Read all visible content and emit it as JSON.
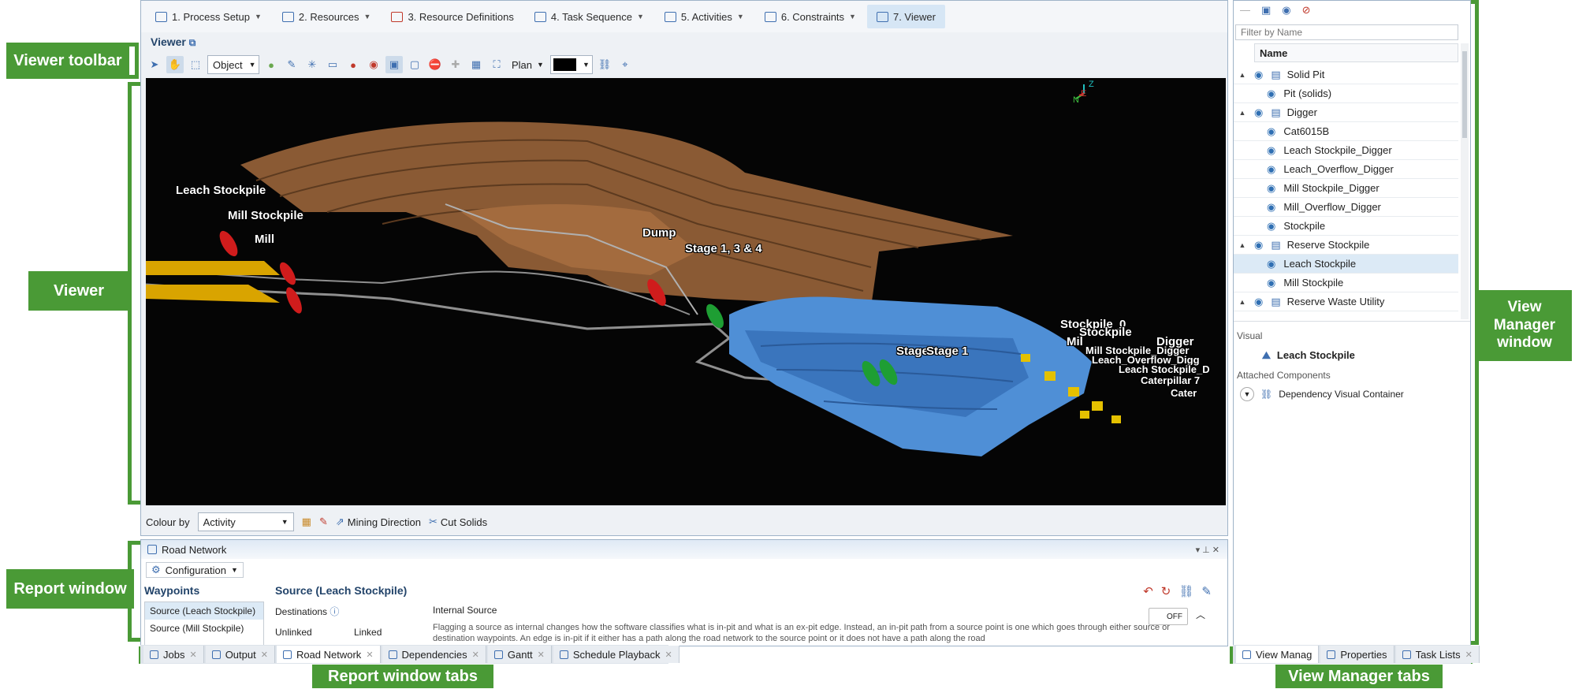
{
  "callouts": {
    "viewer_toolbar": "Viewer toolbar",
    "viewer": "Viewer",
    "report_window": "Report window",
    "report_window_tabs": "Report window tabs",
    "view_manager_window": "View Manager window",
    "view_manager_tabs": "View Manager tabs"
  },
  "tabs": [
    {
      "label": "1. Process Setup",
      "has_menu": true
    },
    {
      "label": "2. Resources",
      "has_menu": true
    },
    {
      "label": "3. Resource Definitions",
      "has_menu": false
    },
    {
      "label": "4. Task Sequence",
      "has_menu": true
    },
    {
      "label": "5. Activities",
      "has_menu": true
    },
    {
      "label": "6. Constraints",
      "has_menu": true
    },
    {
      "label": "7. Viewer",
      "has_menu": false
    }
  ],
  "viewer": {
    "title": "Viewer",
    "select_mode": "Object",
    "view_mode": "Plan",
    "labels": {
      "leach_stockpile": "Leach Stockpile",
      "mill_stockpile": "Mill Stockpile",
      "mill": "Mill",
      "dump": "Dump",
      "stage_134": "Stage 1, 3 & 4",
      "stage_1": "Stage 1",
      "stage_overlap": "Stage",
      "stockpile_0": "Stockpile_0",
      "stockpile": "Stockpile",
      "mill_short": "Mil",
      "digger": "Digger",
      "cat": "Caterpillar 7",
      "cat2": "Cater",
      "leach_overflow": "Leach_Overflow_Digg",
      "leach_stockpile_d": "Leach Stockpile_D",
      "mill_stockpile_digger": "Mill Stockpile_Digger"
    },
    "axis": {
      "z": "Z",
      "e": "E",
      "n": "N"
    }
  },
  "colour_bar": {
    "label": "Colour by",
    "value": "Activity",
    "mining_direction": "Mining Direction",
    "cut_solids": "Cut Solids"
  },
  "report": {
    "title": "Road Network",
    "configuration": "Configuration",
    "waypoints_heading": "Waypoints",
    "waypoints": [
      "Source (Leach Stockpile)",
      "Source (Mill Stockpile)"
    ],
    "source_heading": "Source (Leach Stockpile)",
    "destinations": "Destinations",
    "unlinked": "Unlinked",
    "linked": "Linked",
    "internal_source": "Internal Source",
    "toggle": "OFF",
    "description": "Flagging a source as internal changes how the software classifies what is in-pit and what is an ex-pit edge. Instead, an in-pit path from a source point is one which goes through either source or destination waypoints. An edge is in-pit if it either has a path along the road network to the source point or it does not have a path along the road"
  },
  "report_tabs": [
    "Jobs",
    "Output",
    "Road Network",
    "Dependencies",
    "Gantt",
    "Schedule Playback"
  ],
  "view_manager": {
    "filter_placeholder": "Filter by Name",
    "column": "Name",
    "items": [
      {
        "label": "Solid Pit",
        "level": 0
      },
      {
        "label": "Pit (solids)",
        "level": 1
      },
      {
        "label": "Digger",
        "level": 0
      },
      {
        "label": "Cat6015B",
        "level": 1
      },
      {
        "label": "Leach Stockpile_Digger",
        "level": 1
      },
      {
        "label": "Leach_Overflow_Digger",
        "level": 1
      },
      {
        "label": "Mill Stockpile_Digger",
        "level": 1
      },
      {
        "label": "Mill_Overflow_Digger",
        "level": 1
      },
      {
        "label": "Stockpile",
        "level": 1
      },
      {
        "label": "Reserve Stockpile",
        "level": 0
      },
      {
        "label": "Leach Stockpile",
        "level": 1
      },
      {
        "label": "Mill Stockpile",
        "level": 1
      },
      {
        "label": "Reserve Waste Utility",
        "level": 0
      }
    ],
    "visual_heading": "Visual",
    "visual_item": "Leach Stockpile",
    "attached_heading": "Attached Components",
    "attached_item": "Dependency Visual Container"
  },
  "vm_tabs": [
    "View Manag",
    "Properties",
    "Task Lists"
  ]
}
